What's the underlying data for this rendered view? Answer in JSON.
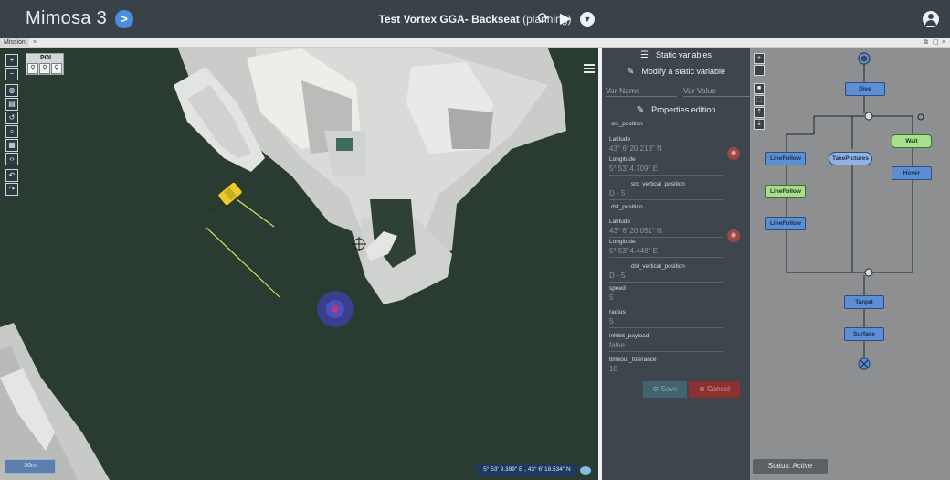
{
  "header": {
    "app_title": "Mimosa 3",
    "nav_button": ">",
    "mission_name": "Test Vortex GGA- Backseat",
    "mission_state": "(planning)",
    "icons": [
      "sync-icon",
      "play-icon",
      "dropdown-icon",
      "account-icon"
    ]
  },
  "tabbar": {
    "tab_label": "Mission",
    "close": "×"
  },
  "map": {
    "poi_label": "POI",
    "scale_label": "30m",
    "coords": "5° 53' 9.399\" E , 43° 6' 18.534\" N"
  },
  "props": {
    "static_variables": "Static variables",
    "modify_variable": "Modify a static variable",
    "var_name_placeholder": "Var Name",
    "var_value_placeholder": "Var Value",
    "properties_edition": "Properties edition",
    "src_position": "src_position",
    "src_latitude_label": "Latitude",
    "src_latitude": "43° 6' 20.213\" N",
    "src_longitude_label": "Longitude",
    "src_longitude": "5° 53' 4.709\" E",
    "src_vertical_position": "src_vertical_position",
    "src_vertical_value": "D  -  5",
    "dst_position": "dst_position",
    "dst_latitude_label": "Latitude",
    "dst_latitude": "43° 6' 20.051\" N",
    "dst_longitude_label": "Longitude",
    "dst_longitude": "5° 53' 4.448\" E",
    "dst_vertical_position": "dst_vertical_position",
    "dst_vertical_value": "D  -  5",
    "speed_label": "speed",
    "speed": "5",
    "radius_label": "radius",
    "radius": "5",
    "inhibit_label": "inhibit_payload",
    "inhibit": "false",
    "timeout_label": "timeout_tolerance",
    "timeout": "10",
    "save": "Save",
    "cancel": "Cancel"
  },
  "graph": {
    "nodes": {
      "dive": "Dive",
      "linefollow_1": "LineFollow",
      "takepictures": "TakePictures",
      "wait": "Wait",
      "linefollow_2": "LineFollow",
      "hover": "Hover",
      "linefollow_3": "LineFollow",
      "target": "Target",
      "surface": "Surface"
    },
    "status": "Status: Active"
  }
}
